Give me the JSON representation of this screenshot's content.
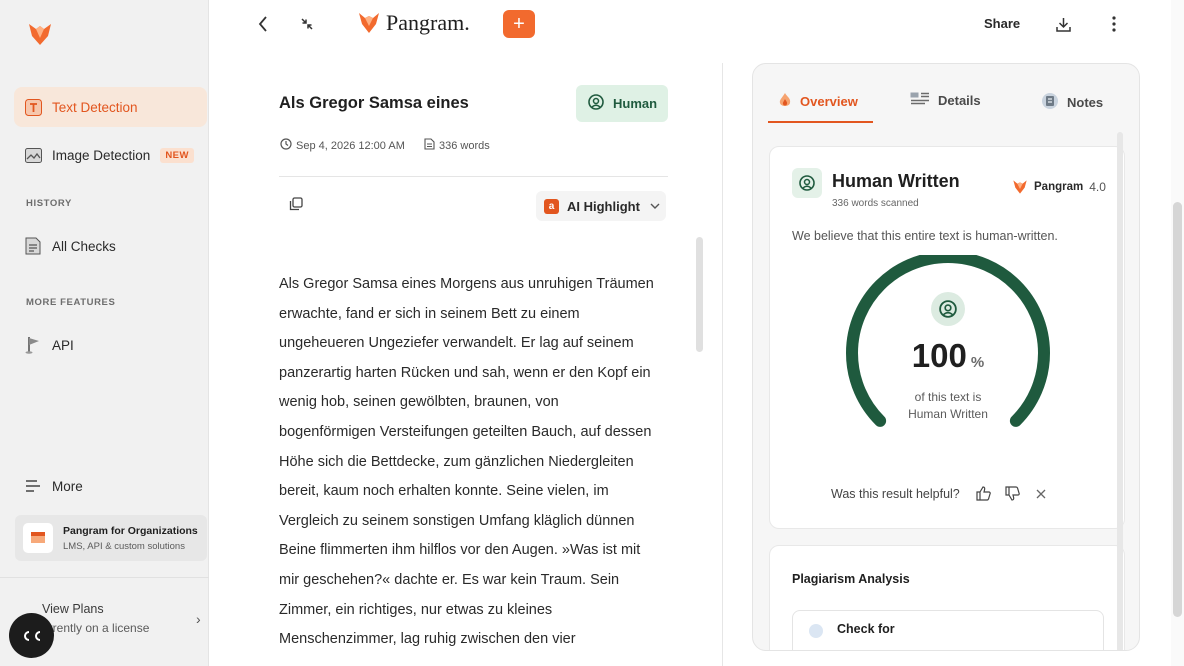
{
  "sidebar": {
    "nav": [
      {
        "label": "Text Detection",
        "icon": "text-detection-icon",
        "active": true
      },
      {
        "label": "Image Detection",
        "icon": "image-detection-icon",
        "badge": "NEW"
      }
    ],
    "history_heading": "HISTORY",
    "history_items": [
      {
        "label": "All Checks",
        "icon": "document-icon"
      }
    ],
    "more_features_heading": "MORE FEATURES",
    "feature_items": [
      {
        "label": "API",
        "icon": "flag-icon"
      }
    ],
    "more_label": "More",
    "org_card": {
      "title": "Pangram for Organizations",
      "subtitle": "LMS, API & custom solutions"
    },
    "plans": {
      "title": "View Plans",
      "subtitle": "urrently on a license"
    }
  },
  "topbar": {
    "brand_name": "Pangram.",
    "plus_label": "+",
    "share_label": "Share"
  },
  "document": {
    "title": "Als Gregor Samsa eines",
    "status_label": "Human",
    "date": "Sep 4, 2026 12:00 AM",
    "word_count": "336 words",
    "highlight_mode": "AI Highlight",
    "highlight_badge": "a",
    "body_lines": [
      "Als Gregor Samsa eines Morgens aus unruhigen Träumen",
      "erwachte, fand er sich in seinem Bett zu einem",
      "ungeheueren Ungeziefer verwandelt. Er lag auf seinem",
      "panzerartig harten Rücken und sah, wenn er den Kopf ein",
      "wenig hob, seinen gewölbten, braunen, von",
      "bogenförmigen Versteifungen geteilten Bauch, auf dessen",
      "Höhe sich die Bettdecke, zum gänzlichen Niedergleiten",
      "bereit, kaum noch erhalten konnte. Seine vielen, im",
      "Vergleich zu seinem sonstigen Umfang kläglich dünnen",
      "Beine flimmerten ihm hilflos vor den Augen. »Was ist mit",
      "mir geschehen?« dachte er. Es war kein Traum. Sein",
      "Zimmer, ein richtiges, nur etwas zu kleines",
      "Menschenzimmer, lag ruhig zwischen den vier"
    ]
  },
  "panel": {
    "tabs": [
      {
        "label": "Overview",
        "icon": "overview-icon",
        "active": true
      },
      {
        "label": "Details",
        "icon": "details-icon"
      },
      {
        "label": "Notes",
        "icon": "notes-icon"
      }
    ],
    "result": {
      "title": "Human Written",
      "subtitle": "336 words scanned",
      "brand": "Pangram",
      "version": "4.0",
      "description": "We believe that this entire text is human-written.",
      "percent": 100,
      "percent_text": "100",
      "percent_unit": "%",
      "caption_line1": "of this text is",
      "caption_line2": "Human Written",
      "feedback_prompt": "Was this result helpful?"
    },
    "plagiarism": {
      "title": "Plagiarism Analysis",
      "check_label": "Check for"
    }
  },
  "colors": {
    "accent": "#e2561f",
    "human_green": "#1f5a3e",
    "gauge_green": "#1f5a3e",
    "pill_bg": "#dff1e5"
  }
}
